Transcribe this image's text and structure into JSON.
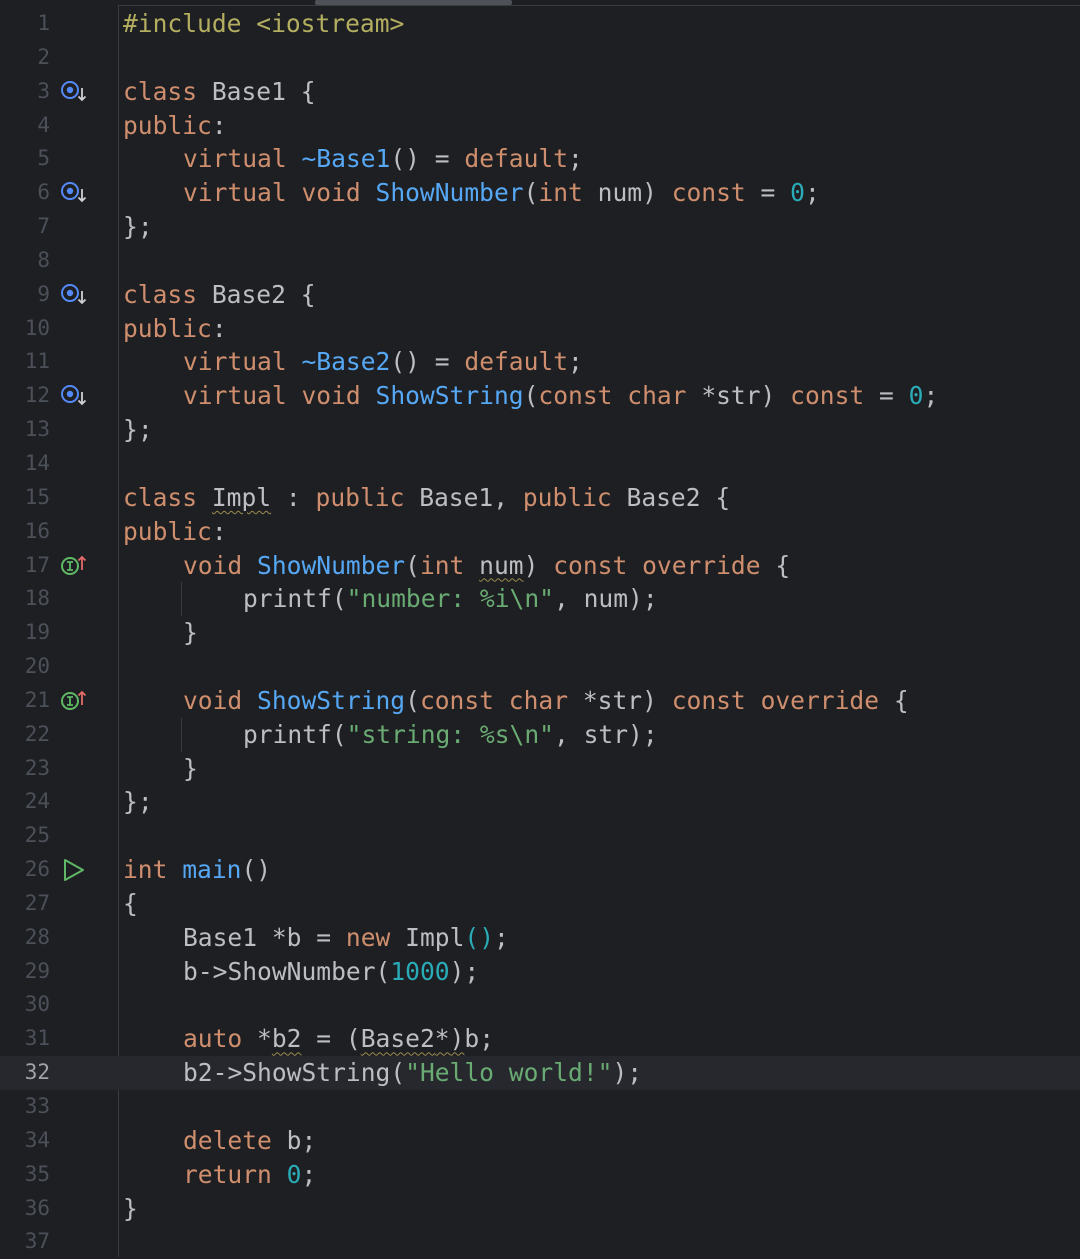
{
  "editor": {
    "language": "C++",
    "current_line": 32,
    "colors": {
      "background": "#1e1f22",
      "current_line_bg": "#26282e",
      "keyword": "#cf8e6d",
      "function": "#56a8f5",
      "string": "#6aab73",
      "number": "#2aacb8",
      "preprocessor": "#b3ae60",
      "text": "#bcbec4",
      "line_number": "#4b5059"
    },
    "gutter_icons": [
      {
        "line": 3,
        "icon": "has-implementations-icon"
      },
      {
        "line": 6,
        "icon": "has-implementations-icon"
      },
      {
        "line": 9,
        "icon": "has-implementations-icon"
      },
      {
        "line": 12,
        "icon": "has-implementations-icon"
      },
      {
        "line": 17,
        "icon": "implements-method-icon"
      },
      {
        "line": 21,
        "icon": "implements-method-icon"
      },
      {
        "line": 26,
        "icon": "run-icon"
      }
    ],
    "lines": [
      {
        "n": "1",
        "text": "#include <iostream>"
      },
      {
        "n": "2",
        "text": ""
      },
      {
        "n": "3",
        "text": "class Base1 {"
      },
      {
        "n": "4",
        "text": "public:"
      },
      {
        "n": "5",
        "text": "    virtual ~Base1() = default;"
      },
      {
        "n": "6",
        "text": "    virtual void ShowNumber(int num) const = 0;"
      },
      {
        "n": "7",
        "text": "};"
      },
      {
        "n": "8",
        "text": ""
      },
      {
        "n": "9",
        "text": "class Base2 {"
      },
      {
        "n": "10",
        "text": "public:"
      },
      {
        "n": "11",
        "text": "    virtual ~Base2() = default;"
      },
      {
        "n": "12",
        "text": "    virtual void ShowString(const char *str) const = 0;"
      },
      {
        "n": "13",
        "text": "};"
      },
      {
        "n": "14",
        "text": ""
      },
      {
        "n": "15",
        "text": "class Impl : public Base1, public Base2 {"
      },
      {
        "n": "16",
        "text": "public:"
      },
      {
        "n": "17",
        "text": "    void ShowNumber(int num) const override {"
      },
      {
        "n": "18",
        "text": "        printf(\"number: %i\\n\", num);"
      },
      {
        "n": "19",
        "text": "    }"
      },
      {
        "n": "20",
        "text": ""
      },
      {
        "n": "21",
        "text": "    void ShowString(const char *str) const override {"
      },
      {
        "n": "22",
        "text": "        printf(\"string: %s\\n\", str);"
      },
      {
        "n": "23",
        "text": "    }"
      },
      {
        "n": "24",
        "text": "};"
      },
      {
        "n": "25",
        "text": ""
      },
      {
        "n": "26",
        "text": "int main()"
      },
      {
        "n": "27",
        "text": "{"
      },
      {
        "n": "28",
        "text": "    Base1 *b = new Impl();"
      },
      {
        "n": "29",
        "text": "    b->ShowNumber(1000);"
      },
      {
        "n": "30",
        "text": ""
      },
      {
        "n": "31",
        "text": "    auto *b2 = (Base2*)b;"
      },
      {
        "n": "32",
        "text": "    b2->ShowString(\"Hello world!\");"
      },
      {
        "n": "33",
        "text": ""
      },
      {
        "n": "34",
        "text": "    delete b;"
      },
      {
        "n": "35",
        "text": "    return 0;"
      },
      {
        "n": "36",
        "text": "}"
      },
      {
        "n": "37",
        "text": ""
      }
    ]
  }
}
